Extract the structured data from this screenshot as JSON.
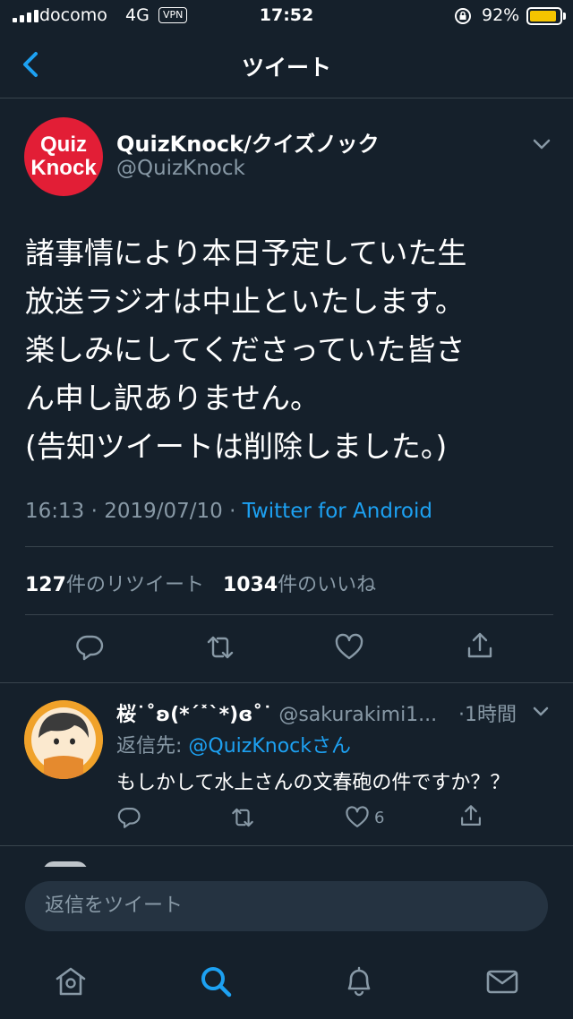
{
  "status_bar": {
    "carrier": "docomo",
    "network": "4G",
    "vpn": "VPN",
    "time": "17:52",
    "battery_percent": "92%",
    "battery_level": 0.92
  },
  "header": {
    "title": "ツイート",
    "back_icon": "chevron-left-icon"
  },
  "tweet": {
    "avatar_lines": [
      "Quiz",
      "Knock"
    ],
    "author_name": "QuizKnock/クイズノック",
    "author_handle": "@QuizKnock",
    "body_lines": [
      "諸事情により本日予定していた生",
      "放送ラジオは中止といたします。",
      "楽しみにしてくださっていた皆さ",
      "ん申し訳ありません。",
      "(告知ツイートは削除しました。)"
    ],
    "timestamp": "16:13 · 2019/07/10 · ",
    "source": "Twitter for Android",
    "retweet_count": "127",
    "retweet_label": "件のリツイート",
    "like_count": "1034",
    "like_label": "件のいいね"
  },
  "reply": {
    "author_name": "桜˙˚ʚ(*ˊ˟ˋ*)ɞ˚˙",
    "author_handle": "@sakurakimi1...",
    "time": "·1時間",
    "reply_to_prefix": "返信先: ",
    "reply_to_mention": "@QuizKnockさん",
    "text": "もしかして水上さんの文春砲の件ですか？？",
    "like_count": "6"
  },
  "compose": {
    "placeholder": "返信をツイート"
  },
  "colors": {
    "background": "#15202b",
    "accent": "#1da1f2",
    "secondary_text": "#8899a6",
    "divider": "#38444d",
    "brand_red": "#e21e36"
  }
}
